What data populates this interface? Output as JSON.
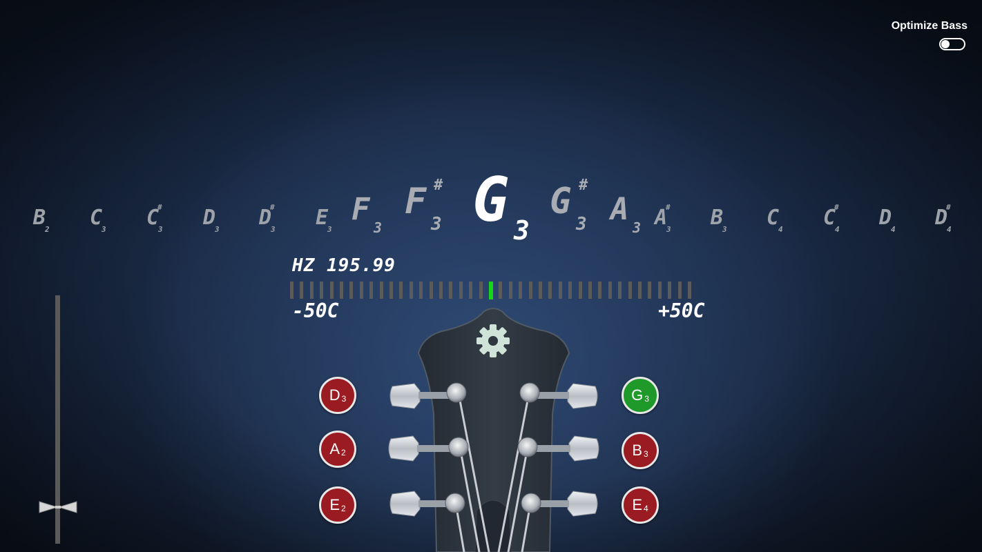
{
  "header": {
    "optimize_bass_label": "Optimize Bass",
    "optimize_bass_on": false
  },
  "notes": {
    "left": [
      {
        "letter": "B",
        "octave": "2",
        "sharp": ""
      },
      {
        "letter": "C",
        "octave": "3",
        "sharp": ""
      },
      {
        "letter": "C",
        "octave": "3",
        "sharp": "#"
      },
      {
        "letter": "D",
        "octave": "3",
        "sharp": ""
      },
      {
        "letter": "D",
        "octave": "3",
        "sharp": "#"
      },
      {
        "letter": "E",
        "octave": "3",
        "sharp": ""
      }
    ],
    "near_left": [
      {
        "letter": "F",
        "octave": "3",
        "sharp": ""
      },
      {
        "letter": "F",
        "octave": "3",
        "sharp": "#"
      }
    ],
    "current": {
      "letter": "G",
      "octave": "3"
    },
    "near_right": [
      {
        "letter": "G",
        "octave": "3",
        "sharp": "#"
      },
      {
        "letter": "A",
        "octave": "3",
        "sharp": ""
      }
    ],
    "right": [
      {
        "letter": "A",
        "octave": "3",
        "sharp": "#"
      },
      {
        "letter": "B",
        "octave": "3",
        "sharp": ""
      },
      {
        "letter": "C",
        "octave": "4",
        "sharp": ""
      },
      {
        "letter": "C",
        "octave": "4",
        "sharp": "#"
      },
      {
        "letter": "D",
        "octave": "4",
        "sharp": ""
      },
      {
        "letter": "D",
        "octave": "4",
        "sharp": "#"
      }
    ]
  },
  "meter": {
    "hz_text": "HZ 195.99",
    "min_label": "-50C",
    "max_label": "+50C",
    "needle_cents": 0,
    "needle_color": "#19d419"
  },
  "strings": {
    "left": [
      {
        "note": "D",
        "octave": "3",
        "active": false
      },
      {
        "note": "A",
        "octave": "2",
        "active": false
      },
      {
        "note": "E",
        "octave": "2",
        "active": false
      }
    ],
    "right": [
      {
        "note": "G",
        "octave": "3",
        "active": true
      },
      {
        "note": "B",
        "octave": "3",
        "active": false
      },
      {
        "note": "E",
        "octave": "4",
        "active": false
      }
    ]
  },
  "colors": {
    "string_idle": "#9b1b22",
    "string_active": "#1f9a2a",
    "headstock": "#2c343d"
  },
  "icons": {
    "settings": "gear-icon"
  }
}
